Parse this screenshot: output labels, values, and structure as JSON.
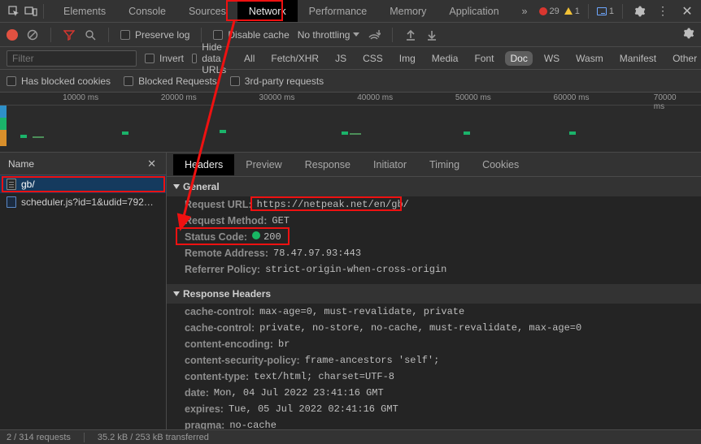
{
  "topbar": {
    "tabs": [
      "Elements",
      "Console",
      "Sources",
      "Network",
      "Performance",
      "Memory",
      "Application"
    ],
    "selected": "Network",
    "more_glyph": "»",
    "errors": "29",
    "warnings": "1",
    "issues": "1"
  },
  "toolbar2": {
    "preserve_log": "Preserve log",
    "disable_cache": "Disable cache",
    "throttle": "No throttling"
  },
  "filterbar": {
    "placeholder": "Filter",
    "invert": "Invert",
    "hide_data_urls": "Hide data URLs",
    "types": [
      "All",
      "Fetch/XHR",
      "JS",
      "CSS",
      "Img",
      "Media",
      "Font",
      "Doc",
      "WS",
      "Wasm",
      "Manifest",
      "Other"
    ],
    "active_type": "Doc"
  },
  "optsbar": {
    "blocked_cookies": "Has blocked cookies",
    "blocked_requests": "Blocked Requests",
    "third_party": "3rd-party requests"
  },
  "timeline": {
    "ticks": [
      "10000 ms",
      "20000 ms",
      "30000 ms",
      "40000 ms",
      "50000 ms",
      "60000 ms",
      "70000 ms"
    ]
  },
  "left": {
    "header": "Name",
    "items": [
      {
        "icon": "doc",
        "label": "gb/",
        "active": true
      },
      {
        "icon": "js",
        "label": "scheduler.js?id=1&udid=792…",
        "active": false
      }
    ]
  },
  "detail": {
    "tabs": [
      "Headers",
      "Preview",
      "Response",
      "Initiator",
      "Timing",
      "Cookies"
    ],
    "selected": "Headers",
    "general_title": "General",
    "general": {
      "request_url_k": "Request URL:",
      "request_url_v": "https://netpeak.net/en/gb/",
      "request_method_k": "Request Method:",
      "request_method_v": "GET",
      "status_code_k": "Status Code:",
      "status_code_v": "200",
      "remote_addr_k": "Remote Address:",
      "remote_addr_v": "78.47.97.93:443",
      "referrer_k": "Referrer Policy:",
      "referrer_v": "strict-origin-when-cross-origin"
    },
    "response_title": "Response Headers",
    "response": [
      {
        "k": "cache-control:",
        "v": "max-age=0, must-revalidate, private"
      },
      {
        "k": "cache-control:",
        "v": "private, no-store, no-cache, must-revalidate, max-age=0"
      },
      {
        "k": "content-encoding:",
        "v": "br"
      },
      {
        "k": "content-security-policy:",
        "v": "frame-ancestors 'self';"
      },
      {
        "k": "content-type:",
        "v": "text/html; charset=UTF-8"
      },
      {
        "k": "date:",
        "v": "Mon, 04 Jul 2022 23:41:16 GMT"
      },
      {
        "k": "expires:",
        "v": "Tue, 05 Jul 2022 02:41:16 GMT"
      },
      {
        "k": "pragma:",
        "v": "no-cache"
      }
    ]
  },
  "status": {
    "requests": "2 / 314 requests",
    "size": "35.2 kB / 253 kB transferred"
  }
}
